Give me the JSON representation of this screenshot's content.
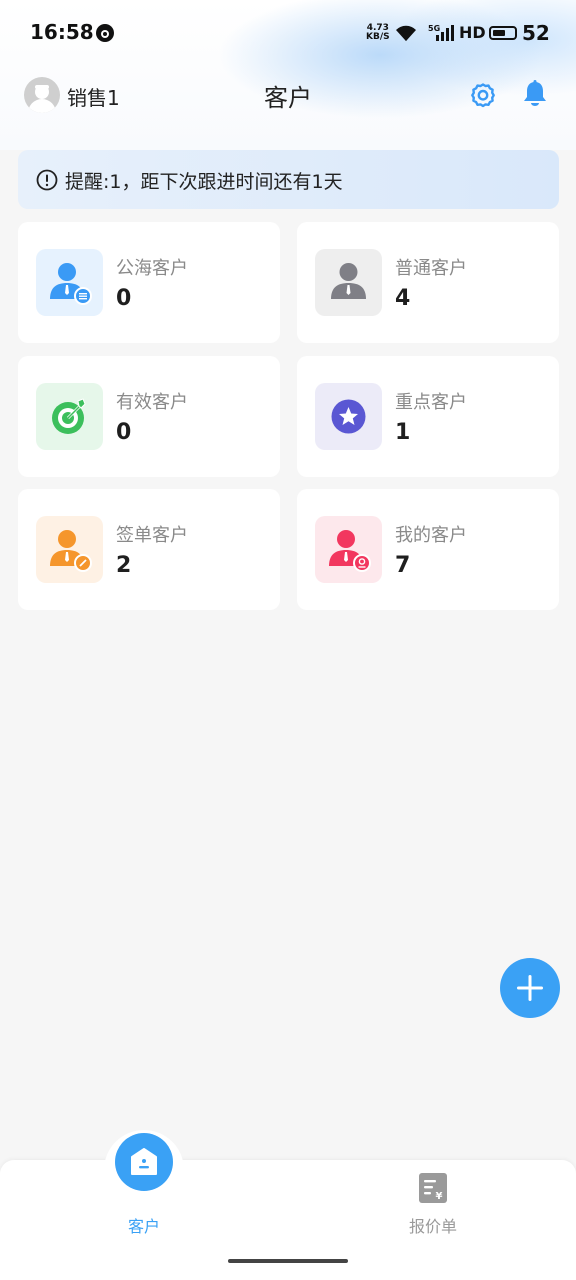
{
  "status_bar": {
    "time": "16:58",
    "speed_top": "4.73",
    "speed_bottom": "KB/S",
    "network": "5G",
    "hd": "HD",
    "battery": "52"
  },
  "header": {
    "user_name": "销售1",
    "title": "客户",
    "avatar_icon": "user-avatar-icon",
    "settings_icon": "gear-icon",
    "notification_icon": "bell-icon"
  },
  "reminder": {
    "icon": "exclamation-circle-icon",
    "text": "提醒:1，距下次跟进时间还有1天"
  },
  "categories": [
    {
      "label": "公海客户",
      "count": "0",
      "icon": "public-customer-icon",
      "color": "#3a9af5",
      "bg": "#e6f2fe"
    },
    {
      "label": "普通客户",
      "count": "4",
      "icon": "normal-customer-icon",
      "color": "#7f7f86",
      "bg": "#eeeeee"
    },
    {
      "label": "有效客户",
      "count": "0",
      "icon": "target-icon",
      "color": "#3cbf5c",
      "bg": "#e6f7ea"
    },
    {
      "label": "重点客户",
      "count": "1",
      "icon": "star-badge-icon",
      "color": "#5a57d3",
      "bg": "#ecebf8"
    },
    {
      "label": "签单客户",
      "count": "2",
      "icon": "signed-customer-icon",
      "color": "#f5962c",
      "bg": "#fef1e4"
    },
    {
      "label": "我的客户",
      "count": "7",
      "icon": "my-customer-icon",
      "color": "#f2375f",
      "bg": "#fde8ec"
    }
  ],
  "fab": {
    "icon": "plus-icon",
    "color": "#3aa1f5"
  },
  "tab_bar": {
    "active_color": "#3aa1f5",
    "tabs": [
      {
        "label": "客户",
        "icon": "home-icon",
        "active": true
      },
      {
        "label": "报价单",
        "icon": "quote-document-icon",
        "active": false
      }
    ]
  }
}
